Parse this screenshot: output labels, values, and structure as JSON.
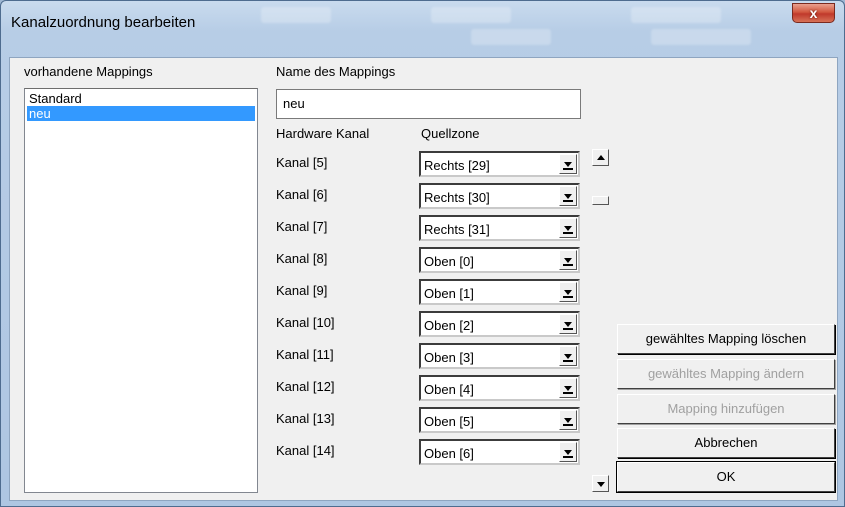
{
  "window": {
    "title": "Kanalzuordnung bearbeiten",
    "close_glyph": "x"
  },
  "mappings": {
    "label": "vorhandene Mappings",
    "items": [
      {
        "label": "Standard",
        "selected": false
      },
      {
        "label": "neu",
        "selected": true
      }
    ]
  },
  "name_field": {
    "label": "Name des Mappings",
    "value": "neu"
  },
  "table": {
    "col_hardware": "Hardware Kanal",
    "col_source": "Quellzone",
    "rows": [
      {
        "channel": "Kanal [5]",
        "zone": "Rechts [29]"
      },
      {
        "channel": "Kanal [6]",
        "zone": "Rechts [30]"
      },
      {
        "channel": "Kanal [7]",
        "zone": "Rechts [31]"
      },
      {
        "channel": "Kanal [8]",
        "zone": "Oben [0]"
      },
      {
        "channel": "Kanal [9]",
        "zone": "Oben [1]"
      },
      {
        "channel": "Kanal [10]",
        "zone": "Oben [2]"
      },
      {
        "channel": "Kanal [11]",
        "zone": "Oben [3]"
      },
      {
        "channel": "Kanal [12]",
        "zone": "Oben [4]"
      },
      {
        "channel": "Kanal [13]",
        "zone": "Oben [5]"
      },
      {
        "channel": "Kanal [14]",
        "zone": "Oben [6]"
      }
    ]
  },
  "buttons": {
    "delete": "gewähltes Mapping löschen",
    "change": "gewähltes Mapping ändern",
    "add": "Mapping hinzufügen",
    "cancel": "Abbrechen",
    "ok": "OK"
  },
  "colors": {
    "selection": "#3399ff",
    "close_button": "#c0392b"
  }
}
